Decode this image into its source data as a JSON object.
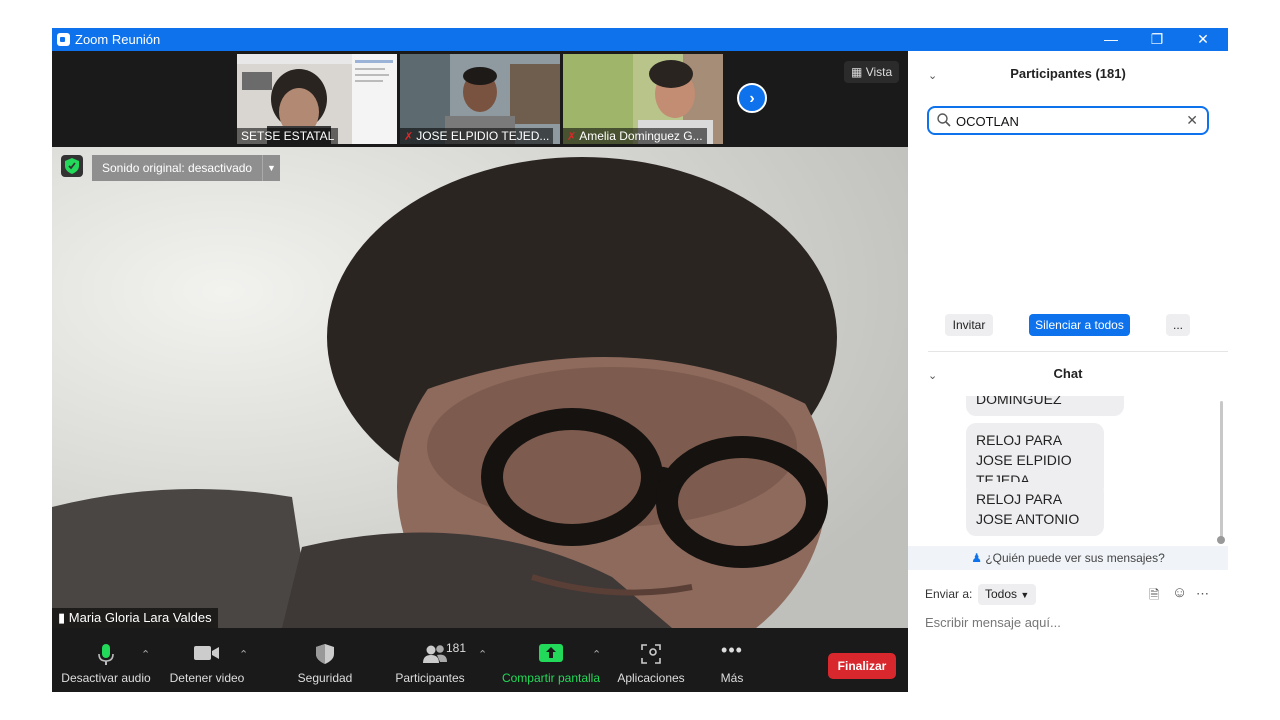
{
  "window": {
    "title": "Zoom Reunión"
  },
  "video_strip": {
    "thumbnails": [
      {
        "name": "SETSE ESTATAL",
        "muted": false
      },
      {
        "name": "JOSE ELPIDIO TEJED...",
        "muted": true
      },
      {
        "name": "Amelia Dominguez G...",
        "muted": true
      }
    ],
    "view_label": "Vista"
  },
  "main_video": {
    "sound_label": "Sonido original: desactivado",
    "speaker_name": "Maria Gloria Lara Valdes"
  },
  "toolbar": {
    "audio_label": "Desactivar audio",
    "video_label": "Detener video",
    "security_label": "Seguridad",
    "participants_label": "Participantes",
    "participants_count": "181",
    "share_label": "Compartir pantalla",
    "apps_label": "Aplicaciones",
    "more_label": "Más",
    "end_label": "Finalizar"
  },
  "participants_panel": {
    "title": "Participantes (181)",
    "search_value": "OCOTLAN",
    "invite_label": "Invitar",
    "mute_all_label": "Silenciar a todos",
    "more_label": "..."
  },
  "chat": {
    "title": "Chat",
    "messages": [
      "DOMINGUEZ",
      "RELOJ PARA JOSE ELPIDIO TEJEDA",
      "RELOJ PARA JOSE ANTONIO"
    ],
    "who_can_see": "¿Quién puede ver sus mensajes?",
    "send_to_label": "Enviar a:",
    "send_to_value": "Todos",
    "input_placeholder": "Escribir mensaje aquí..."
  },
  "colors": {
    "accent": "#0e72ed",
    "end_button": "#d8282e",
    "share_green": "#23d959"
  }
}
